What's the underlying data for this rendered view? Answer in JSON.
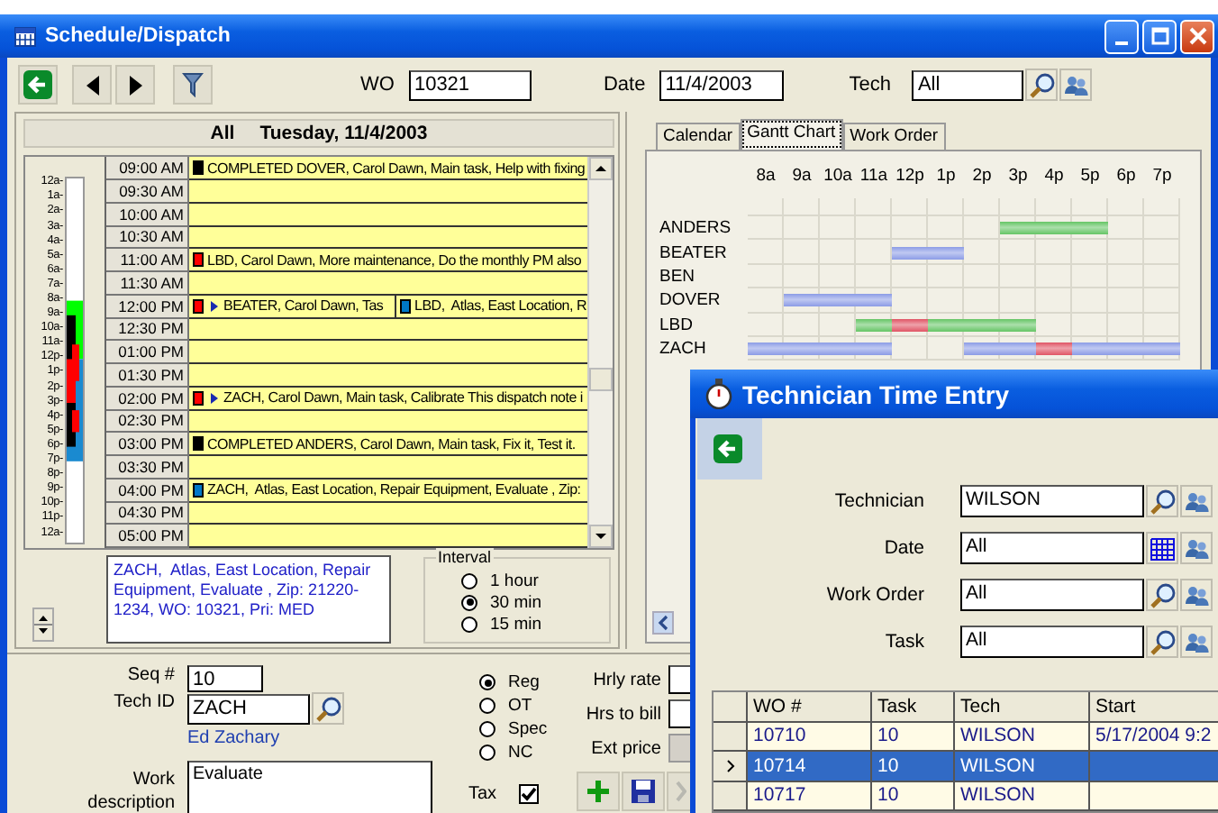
{
  "main_window": {
    "title": "Schedule/Dispatch"
  },
  "toolbar": {
    "wo_label": "WO",
    "wo": "10321",
    "date_label": "Date",
    "date": "11/4/2003",
    "tech_label": "Tech",
    "tech": "All"
  },
  "schedule": {
    "tech": "All",
    "day": "Tuesday, 11/4/2003",
    "overview_labels": [
      "12a-",
      "1a-",
      "2a-",
      "3a-",
      "4a-",
      "5a-",
      "6a-",
      "7a-",
      "8a-",
      "9a-",
      "10a-",
      "11a-",
      "12p-",
      "1p-",
      "2p-",
      "3p-",
      "4p-",
      "5p-",
      "6p-",
      "7p-",
      "8p-",
      "9p-",
      "10p-",
      "11p-",
      "12a-"
    ],
    "rows": [
      {
        "time": "09:00 AM",
        "entries": [
          {
            "color": "#000000",
            "flagged": false,
            "text": "COMPLETED DOVER, Carol Dawn, Main task, Help with fixing"
          }
        ]
      },
      {
        "time": "09:30 AM",
        "entries": []
      },
      {
        "time": "10:00 AM",
        "entries": []
      },
      {
        "time": "10:30 AM",
        "entries": []
      },
      {
        "time": "11:00 AM",
        "entries": [
          {
            "color": "#ff0000",
            "flagged": false,
            "text": "LBD, Carol Dawn, More maintenance, Do the monthly PM also"
          }
        ]
      },
      {
        "time": "11:30 AM",
        "entries": []
      },
      {
        "time": "12:00 PM",
        "entries": [
          {
            "color": "#ff0000",
            "flagged": true,
            "text": "BEATER, Carol Dawn, Tas"
          },
          {
            "color": "#0078c8",
            "flagged": false,
            "text": "LBD,  Atlas, East Location, R"
          }
        ]
      },
      {
        "time": "12:30 PM",
        "entries": []
      },
      {
        "time": "01:00 PM",
        "entries": []
      },
      {
        "time": "01:30 PM",
        "entries": []
      },
      {
        "time": "02:00 PM",
        "entries": [
          {
            "color": "#ff0000",
            "flagged": true,
            "text": "ZACH, Carol Dawn, Main task, Calibrate This dispatch note i"
          }
        ]
      },
      {
        "time": "02:30 PM",
        "entries": []
      },
      {
        "time": "03:00 PM",
        "entries": [
          {
            "color": "#000000",
            "flagged": false,
            "text": "COMPLETED ANDERS, Carol Dawn, Main task, Fix it, Test it."
          }
        ]
      },
      {
        "time": "03:30 PM",
        "entries": []
      },
      {
        "time": "04:00 PM",
        "entries": [
          {
            "color": "#0078c8",
            "flagged": false,
            "text": "ZACH,  Atlas, East Location, Repair Equipment, Evaluate , Zip:"
          }
        ]
      },
      {
        "time": "04:30 PM",
        "entries": []
      },
      {
        "time": "05:00 PM",
        "entries": []
      }
    ]
  },
  "note": "ZACH,  Atlas, East Location, Repair Equipment, Evaluate , Zip: 21220-1234, WO: 10321, Pri: MED",
  "interval": {
    "label": "Interval",
    "options": [
      {
        "label": "1 hour",
        "selected": false
      },
      {
        "label": "30 min",
        "selected": true
      },
      {
        "label": "15 min",
        "selected": false
      }
    ]
  },
  "tabs": [
    {
      "label": "Calendar",
      "selected": false
    },
    {
      "label": "Gantt Chart",
      "selected": true
    },
    {
      "label": "Work Order",
      "selected": false
    }
  ],
  "gantt": {
    "hours": [
      "8a",
      "9a",
      "10a",
      "11a",
      "12p",
      "1p",
      "2p",
      "3p",
      "4p",
      "5p",
      "6p",
      "7p"
    ],
    "rows": [
      {
        "name": "ANDERS",
        "cells": [
          {
            "booked": false
          },
          {
            "booked": false
          },
          {
            "booked": false
          },
          {
            "booked": false
          },
          {
            "booked": false
          },
          {
            "booked": false
          },
          {
            "booked": false
          },
          {
            "booked": true,
            "color": "#66c566"
          },
          {
            "booked": true,
            "color": "#66c566"
          },
          {
            "booked": true,
            "color": "#66c566"
          },
          {
            "booked": false
          },
          {
            "booked": false
          }
        ]
      },
      {
        "name": "BEATER",
        "cells": [
          {
            "booked": false
          },
          {
            "booked": false
          },
          {
            "booked": false
          },
          {
            "booked": false
          },
          {
            "booked": true,
            "color": "#8c9ce6"
          },
          {
            "booked": true,
            "color": "#8c9ce6"
          },
          {
            "booked": false
          },
          {
            "booked": false
          },
          {
            "booked": false
          },
          {
            "booked": false
          },
          {
            "booked": false
          },
          {
            "booked": false
          }
        ]
      },
      {
        "name": "BEN",
        "cells": [
          {
            "booked": false
          },
          {
            "booked": false
          },
          {
            "booked": false
          },
          {
            "booked": false
          },
          {
            "booked": false
          },
          {
            "booked": false
          },
          {
            "booked": false
          },
          {
            "booked": false
          },
          {
            "booked": false
          },
          {
            "booked": false
          },
          {
            "booked": false
          },
          {
            "booked": false
          }
        ]
      },
      {
        "name": "DOVER",
        "cells": [
          {
            "booked": false
          },
          {
            "booked": true,
            "color": "#8c9ce6"
          },
          {
            "booked": true,
            "color": "#8c9ce6"
          },
          {
            "booked": true,
            "color": "#8c9ce6"
          },
          {
            "booked": false
          },
          {
            "booked": false
          },
          {
            "booked": false
          },
          {
            "booked": false
          },
          {
            "booked": false
          },
          {
            "booked": false
          },
          {
            "booked": false
          },
          {
            "booked": false
          }
        ]
      },
      {
        "name": "LBD",
        "cells": [
          {
            "booked": false
          },
          {
            "booked": false
          },
          {
            "booked": false
          },
          {
            "booked": true,
            "color": "#66c566"
          },
          {
            "booked": true,
            "color": "#e05565"
          },
          {
            "booked": true,
            "color": "#66c566"
          },
          {
            "booked": true,
            "color": "#66c566"
          },
          {
            "booked": true,
            "color": "#66c566"
          },
          {
            "booked": false
          },
          {
            "booked": false
          },
          {
            "booked": false
          },
          {
            "booked": false
          }
        ]
      },
      {
        "name": "ZACH",
        "cells": [
          {
            "booked": true,
            "color": "#8c9ce6"
          },
          {
            "booked": true,
            "color": "#8c9ce6"
          },
          {
            "booked": true,
            "color": "#8c9ce6"
          },
          {
            "booked": true,
            "color": "#8c9ce6"
          },
          {
            "booked": false
          },
          {
            "booked": false
          },
          {
            "booked": true,
            "color": "#8c9ce6"
          },
          {
            "booked": true,
            "color": "#8c9ce6"
          },
          {
            "booked": true,
            "color": "#e05565"
          },
          {
            "booked": true,
            "color": "#8c9ce6"
          },
          {
            "booked": true,
            "color": "#8c9ce6"
          },
          {
            "booked": true,
            "color": "#8c9ce6"
          }
        ]
      }
    ]
  },
  "form": {
    "seq_label": "Seq #",
    "seq": "10",
    "tech_id_label": "Tech ID",
    "tech_id": "ZACH",
    "tech_name": "Ed Zachary",
    "work_label": "Work description",
    "work": "Evaluate",
    "rate_types": [
      {
        "label": "Reg",
        "selected": true
      },
      {
        "label": "OT",
        "selected": false
      },
      {
        "label": "Spec",
        "selected": false
      },
      {
        "label": "NC",
        "selected": false
      }
    ],
    "tax_label": "Tax",
    "tax": true,
    "hrly_rate_label": "Hrly rate",
    "hrs_label": "Hrs to bill",
    "ext_price_label": "Ext price"
  },
  "time_entry": {
    "title": "Technician Time Entry",
    "filters": [
      {
        "label": "Technician",
        "value": "WILSON",
        "kind": "search"
      },
      {
        "label": "Date",
        "value": "All",
        "kind": "calendar"
      },
      {
        "label": "Work Order",
        "value": "All",
        "kind": "search"
      },
      {
        "label": "Task",
        "value": "All",
        "kind": "search"
      }
    ],
    "columns": [
      "WO #",
      "Task",
      "Tech",
      "Start"
    ],
    "rows": [
      {
        "cells": [
          "10710",
          "10",
          "WILSON",
          "5/17/2004 9:2"
        ],
        "selected": false
      },
      {
        "cells": [
          "10714",
          "10",
          "WILSON",
          ""
        ],
        "selected": true
      },
      {
        "cells": [
          "10717",
          "10",
          "WILSON",
          ""
        ],
        "selected": false
      }
    ]
  }
}
